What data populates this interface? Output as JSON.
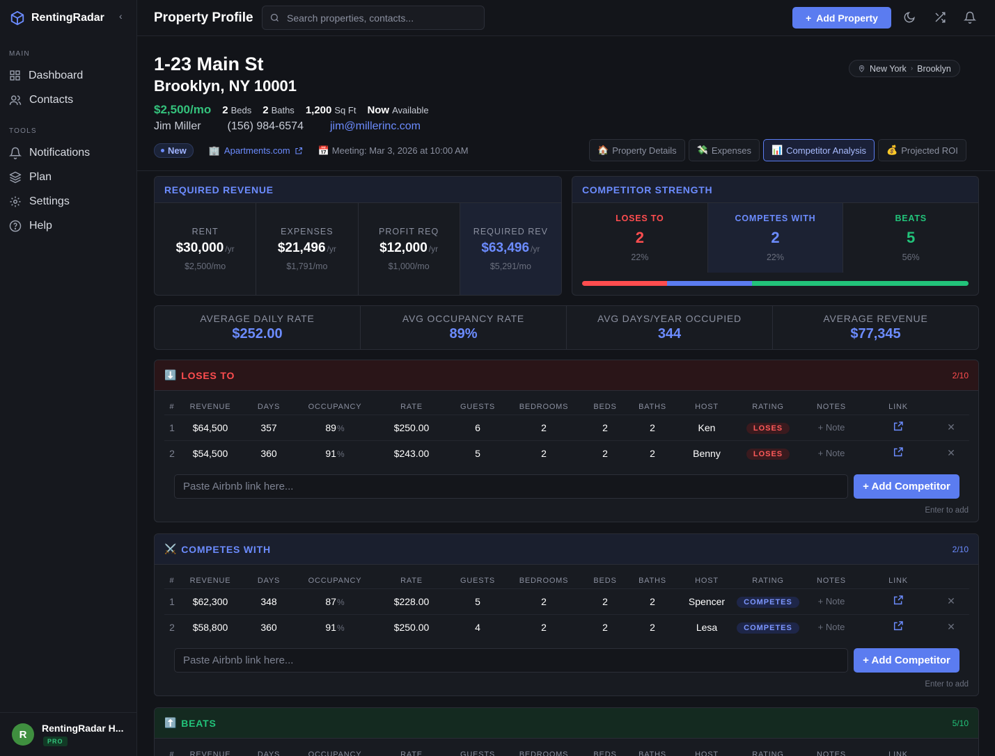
{
  "brand": {
    "name": "RentingRadar"
  },
  "sidebar": {
    "main_label": "MAIN",
    "tools_label": "TOOLS",
    "main_items": [
      {
        "label": "Dashboard",
        "icon": "grid-icon"
      },
      {
        "label": "Contacts",
        "icon": "users-icon"
      }
    ],
    "tool_items": [
      {
        "label": "Notifications",
        "icon": "bell-icon"
      },
      {
        "label": "Plan",
        "icon": "layers-icon"
      },
      {
        "label": "Settings",
        "icon": "gear-icon"
      },
      {
        "label": "Help",
        "icon": "help-circle-icon"
      }
    ],
    "user": {
      "initial": "R",
      "name": "RentingRadar H...",
      "badge": "PRO"
    }
  },
  "header": {
    "title": "Property Profile",
    "search_placeholder": "Search properties, contacts...",
    "add_button": "Add Property"
  },
  "property": {
    "address_line1": "1-23 Main St",
    "address_line2": "Brooklyn, NY 10001",
    "price": "$2,500/mo",
    "beds_value": "2",
    "beds_label": "Beds",
    "baths_value": "2",
    "baths_label": "Baths",
    "sqft_value": "1,200",
    "sqft_label": "Sq Ft",
    "avail_value": "Now",
    "avail_label": "Available",
    "contact_name": "Jim Miller",
    "contact_phone": "(156) 984-6574",
    "contact_email": "jim@millerinc.com",
    "status": "New",
    "source": "Apartments.com",
    "meeting": "Meeting: Mar 3, 2026 at 10:00 AM",
    "location_city": "New York",
    "location_area": "Brooklyn"
  },
  "tabs": [
    {
      "emoji": "🏠",
      "label": "Property Details"
    },
    {
      "emoji": "💸",
      "label": "Expenses"
    },
    {
      "emoji": "📊",
      "label": "Competitor Analysis"
    },
    {
      "emoji": "💰",
      "label": "Projected ROI"
    }
  ],
  "required_revenue": {
    "title": "REQUIRED REVENUE",
    "cells": [
      {
        "label": "RENT",
        "value": "$30,000",
        "unit": "/yr",
        "sub": "$2,500/mo"
      },
      {
        "label": "EXPENSES",
        "value": "$21,496",
        "unit": "/yr",
        "sub": "$1,791/mo"
      },
      {
        "label": "PROFIT REQ",
        "value": "$12,000",
        "unit": "/yr",
        "sub": "$1,000/mo"
      },
      {
        "label": "REQUIRED REV",
        "value": "$63,496",
        "unit": "/yr",
        "sub": "$5,291/mo"
      }
    ]
  },
  "competitor_strength": {
    "title": "COMPETITOR STRENGTH",
    "cells": [
      {
        "label": "LOSES TO",
        "count": "2",
        "pct": "22%",
        "share": 0.22,
        "color": "#ff4d4f"
      },
      {
        "label": "COMPETES WITH",
        "count": "2",
        "pct": "22%",
        "share": 0.22,
        "color": "#5b7cf0"
      },
      {
        "label": "BEATS",
        "count": "5",
        "pct": "56%",
        "share": 0.56,
        "color": "#22c37a"
      }
    ]
  },
  "stats": [
    {
      "label": "AVERAGE DAILY RATE",
      "value": "$252.00"
    },
    {
      "label": "AVG OCCUPANCY RATE",
      "value": "89%"
    },
    {
      "label": "AVG DAYS/YEAR OCCUPIED",
      "value": "344"
    },
    {
      "label": "AVERAGE REVENUE",
      "value": "$77,345"
    }
  ],
  "columns": [
    "#",
    "REVENUE",
    "DAYS",
    "OCCUPANCY",
    "RATE",
    "GUESTS",
    "BEDROOMS",
    "BEDS",
    "BATHS",
    "HOST",
    "RATING",
    "NOTES",
    "LINK",
    ""
  ],
  "loses": {
    "emoji": "⬇️",
    "title": "LOSES TO",
    "count": "2/10",
    "rows": [
      {
        "idx": "1",
        "revenue": "$64,500",
        "days": "357",
        "occ": "89",
        "rate": "$250.00",
        "guests": "6",
        "bedrooms": "2",
        "beds": "2",
        "baths": "2",
        "host": "Ken",
        "rating": "LOSES",
        "note": "+ Note"
      },
      {
        "idx": "2",
        "revenue": "$54,500",
        "days": "360",
        "occ": "91",
        "rate": "$243.00",
        "guests": "5",
        "bedrooms": "2",
        "beds": "2",
        "baths": "2",
        "host": "Benny",
        "rating": "LOSES",
        "note": "+ Note"
      }
    ]
  },
  "competes": {
    "emoji": "⚔️",
    "title": "COMPETES WITH",
    "count": "2/10",
    "rows": [
      {
        "idx": "1",
        "revenue": "$62,300",
        "days": "348",
        "occ": "87",
        "rate": "$228.00",
        "guests": "5",
        "bedrooms": "2",
        "beds": "2",
        "baths": "2",
        "host": "Spencer",
        "rating": "COMPETES",
        "note": "+ Note"
      },
      {
        "idx": "2",
        "revenue": "$58,800",
        "days": "360",
        "occ": "91",
        "rate": "$250.00",
        "guests": "4",
        "bedrooms": "2",
        "beds": "2",
        "baths": "2",
        "host": "Lesa",
        "rating": "COMPETES",
        "note": "+ Note"
      }
    ]
  },
  "beats": {
    "emoji": "⬆️",
    "title": "BEATS",
    "count": "5/10"
  },
  "add_competitor": {
    "placeholder": "Paste Airbnb link here...",
    "button": "+ Add Competitor",
    "hint": "Enter to add"
  },
  "pct_sign": "%",
  "close_glyph": "✕"
}
